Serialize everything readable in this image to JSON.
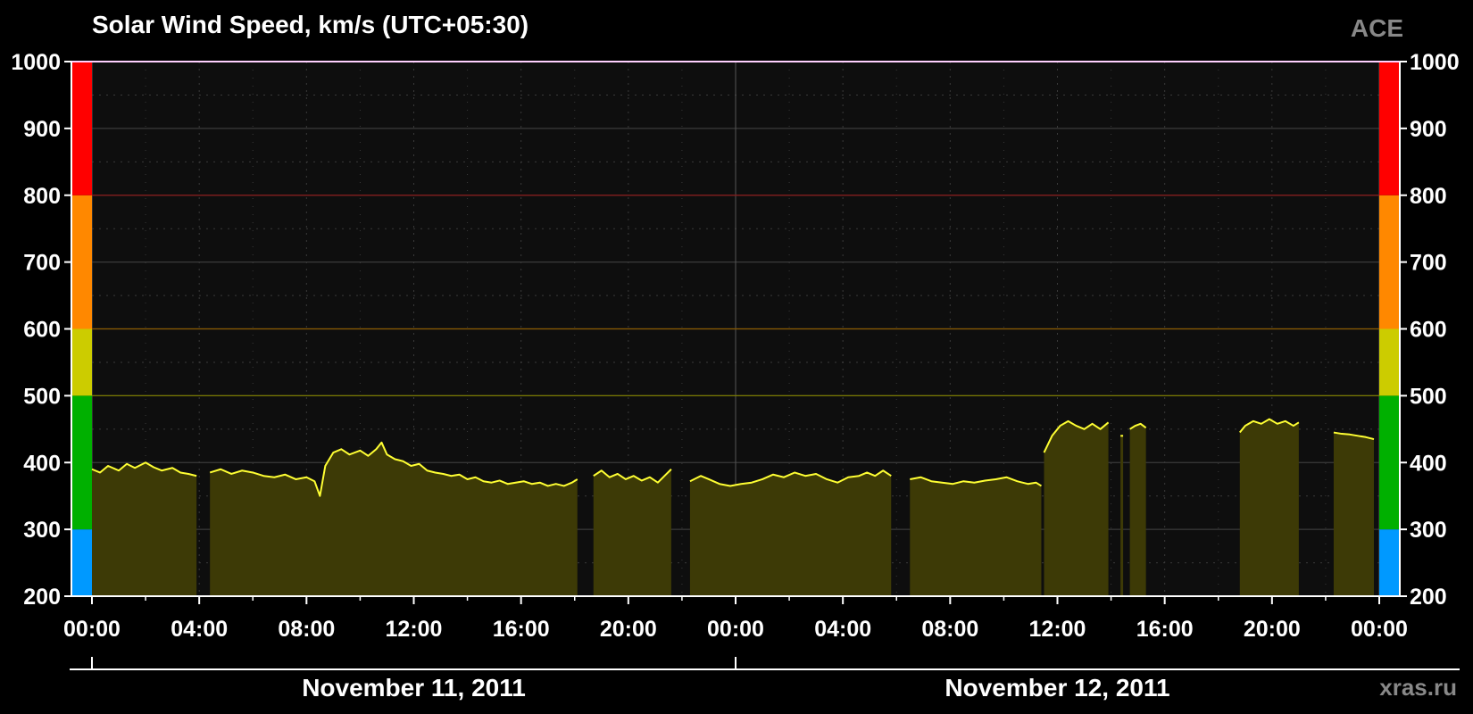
{
  "header": {
    "title": "Solar Wind Speed, km/s (UTC+05:30)",
    "source": "ACE",
    "credit": "xras.ru"
  },
  "colors": {
    "background": "#000000",
    "plot_background": "#0e0e0e",
    "grid": "#3a3a3a",
    "fill": "#3d3a06",
    "line": "#ffff33",
    "zone_blue": "#0099ff",
    "zone_green": "#00b000",
    "zone_yellow": "#cccc00",
    "zone_orange": "#ff8800",
    "zone_red": "#ff0000"
  },
  "chart_data": {
    "type": "area",
    "title": "Solar Wind Speed, km/s (UTC+05:30)",
    "ylabel": "",
    "xlabel": "",
    "ylim": [
      200,
      1000
    ],
    "xlim_hours": [
      0,
      48
    ],
    "y_ticks": [
      "200",
      "300",
      "400",
      "500",
      "600",
      "700",
      "800",
      "900",
      "1000"
    ],
    "x_ticks": [
      "00:00",
      "04:00",
      "08:00",
      "12:00",
      "16:00",
      "20:00",
      "00:00",
      "04:00",
      "08:00",
      "12:00",
      "16:00",
      "20:00",
      "00:00"
    ],
    "dates": [
      "November 11, 2011",
      "November 12, 2011"
    ],
    "speed_zones": [
      {
        "from": 200,
        "to": 300,
        "color": "#0099ff"
      },
      {
        "from": 300,
        "to": 500,
        "color": "#00b000"
      },
      {
        "from": 500,
        "to": 600,
        "color": "#cccc00"
      },
      {
        "from": 600,
        "to": 800,
        "color": "#ff8800"
      },
      {
        "from": 800,
        "to": 1000,
        "color": "#ff0000"
      }
    ],
    "threshold_lines": [
      {
        "value": 500,
        "color": "#7a7a00"
      },
      {
        "value": 600,
        "color": "#8a5a00"
      },
      {
        "value": 800,
        "color": "#8a1a1a"
      }
    ],
    "grid": true,
    "segments": [
      {
        "points": [
          [
            0.0,
            390
          ],
          [
            0.3,
            385
          ],
          [
            0.6,
            395
          ],
          [
            1.0,
            388
          ],
          [
            1.3,
            398
          ],
          [
            1.6,
            392
          ],
          [
            2.0,
            400
          ],
          [
            2.3,
            393
          ],
          [
            2.6,
            388
          ],
          [
            3.0,
            392
          ],
          [
            3.3,
            385
          ],
          [
            3.6,
            383
          ],
          [
            3.9,
            380
          ]
        ]
      },
      {
        "points": [
          [
            4.4,
            385
          ],
          [
            4.8,
            390
          ],
          [
            5.2,
            383
          ],
          [
            5.6,
            388
          ],
          [
            6.0,
            385
          ],
          [
            6.4,
            380
          ],
          [
            6.8,
            378
          ],
          [
            7.2,
            382
          ],
          [
            7.6,
            375
          ],
          [
            8.0,
            378
          ],
          [
            8.3,
            372
          ],
          [
            8.5,
            350
          ],
          [
            8.7,
            395
          ],
          [
            9.0,
            415
          ],
          [
            9.3,
            420
          ],
          [
            9.6,
            412
          ],
          [
            10.0,
            418
          ],
          [
            10.3,
            410
          ],
          [
            10.6,
            420
          ],
          [
            10.8,
            430
          ],
          [
            11.0,
            412
          ],
          [
            11.3,
            405
          ],
          [
            11.6,
            402
          ],
          [
            11.9,
            395
          ],
          [
            12.2,
            398
          ],
          [
            12.5,
            388
          ],
          [
            12.8,
            385
          ],
          [
            13.1,
            383
          ],
          [
            13.4,
            380
          ],
          [
            13.7,
            382
          ],
          [
            14.0,
            375
          ],
          [
            14.3,
            378
          ],
          [
            14.6,
            372
          ],
          [
            14.9,
            370
          ],
          [
            15.2,
            373
          ],
          [
            15.5,
            368
          ],
          [
            15.8,
            370
          ],
          [
            16.1,
            372
          ],
          [
            16.4,
            368
          ],
          [
            16.7,
            370
          ],
          [
            17.0,
            365
          ],
          [
            17.3,
            368
          ],
          [
            17.6,
            365
          ],
          [
            17.9,
            370
          ],
          [
            18.1,
            375
          ]
        ]
      },
      {
        "points": [
          [
            18.7,
            380
          ],
          [
            19.0,
            388
          ],
          [
            19.3,
            378
          ],
          [
            19.6,
            383
          ],
          [
            19.9,
            375
          ],
          [
            20.2,
            380
          ],
          [
            20.5,
            373
          ],
          [
            20.8,
            378
          ],
          [
            21.1,
            370
          ],
          [
            21.4,
            382
          ],
          [
            21.6,
            390
          ]
        ]
      },
      {
        "points": [
          [
            22.3,
            372
          ],
          [
            22.7,
            380
          ],
          [
            23.0,
            375
          ],
          [
            23.4,
            368
          ],
          [
            23.8,
            365
          ],
          [
            24.2,
            368
          ],
          [
            24.6,
            370
          ],
          [
            25.0,
            375
          ],
          [
            25.4,
            382
          ],
          [
            25.8,
            378
          ],
          [
            26.2,
            385
          ],
          [
            26.6,
            380
          ],
          [
            27.0,
            383
          ],
          [
            27.4,
            375
          ],
          [
            27.8,
            370
          ],
          [
            28.2,
            378
          ],
          [
            28.6,
            380
          ],
          [
            28.9,
            385
          ],
          [
            29.2,
            380
          ],
          [
            29.5,
            388
          ],
          [
            29.8,
            380
          ]
        ]
      },
      {
        "points": [
          [
            30.5,
            375
          ],
          [
            30.9,
            378
          ],
          [
            31.3,
            372
          ],
          [
            31.7,
            370
          ],
          [
            32.1,
            368
          ],
          [
            32.5,
            372
          ],
          [
            32.9,
            370
          ],
          [
            33.3,
            373
          ],
          [
            33.7,
            375
          ],
          [
            34.1,
            378
          ],
          [
            34.5,
            372
          ],
          [
            34.9,
            368
          ],
          [
            35.2,
            370
          ],
          [
            35.4,
            365
          ]
        ]
      },
      {
        "points": [
          [
            35.5,
            415
          ],
          [
            35.8,
            440
          ],
          [
            36.1,
            455
          ],
          [
            36.4,
            462
          ],
          [
            36.7,
            455
          ],
          [
            37.0,
            450
          ],
          [
            37.3,
            458
          ],
          [
            37.6,
            450
          ],
          [
            37.9,
            460
          ]
        ]
      },
      {
        "points": [
          [
            38.4,
            440
          ]
        ]
      },
      {
        "points": [
          [
            38.7,
            450
          ],
          [
            38.9,
            455
          ],
          [
            39.1,
            458
          ],
          [
            39.3,
            452
          ]
        ]
      },
      {
        "points": [
          [
            42.8,
            445
          ],
          [
            43.0,
            455
          ],
          [
            43.3,
            462
          ],
          [
            43.6,
            458
          ],
          [
            43.9,
            465
          ],
          [
            44.2,
            458
          ],
          [
            44.5,
            462
          ],
          [
            44.8,
            455
          ],
          [
            45.0,
            460
          ]
        ]
      },
      {
        "points": [
          [
            46.3,
            445
          ],
          [
            46.6,
            443
          ],
          [
            46.9,
            442
          ],
          [
            47.2,
            440
          ],
          [
            47.5,
            438
          ],
          [
            47.8,
            435
          ]
        ]
      }
    ]
  }
}
